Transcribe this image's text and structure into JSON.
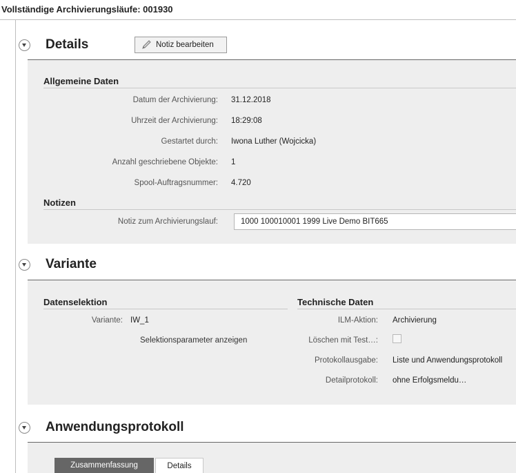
{
  "window": {
    "title": "Vollständige Archivierungsläufe: 001930"
  },
  "details": {
    "title": "Details",
    "edit_note_button": "Notiz bearbeiten",
    "general": {
      "title": "Allgemeine Daten",
      "fields": [
        {
          "label": "Datum der Archivierung:",
          "value": "31.12.2018"
        },
        {
          "label": "Uhrzeit der Archivierung:",
          "value": "18:29:08"
        },
        {
          "label": "Gestartet durch:",
          "value": "Iwona Luther (Wojcicka)"
        },
        {
          "label": "Anzahl geschriebene Objekte:",
          "value": "1"
        },
        {
          "label": "Spool-Auftragsnummer:",
          "value": "4.720"
        }
      ]
    },
    "notes": {
      "title": "Notizen",
      "label": "Notiz zum Archivierungslauf:",
      "value": "1000 100010001 1999 Live Demo BIT665"
    }
  },
  "variant": {
    "title": "Variante",
    "selection": {
      "title": "Datenselektion",
      "variant_label": "Variante:",
      "variant_value": "IW_1",
      "show_params_link": "Selektionsparameter anzeigen"
    },
    "technical": {
      "title": "Technische Daten",
      "ilm_label": "ILM-Aktion:",
      "ilm_value": "Archivierung",
      "delete_test_label": "Löschen mit Test…:",
      "delete_test_checked": false,
      "log_output_label": "Protokollausgabe:",
      "log_output_value": "Liste und Anwendungsprotokoll",
      "detail_log_label": "Detailprotokoll:",
      "detail_log_value": "ohne Erfolgsmeldu…"
    }
  },
  "app_log": {
    "title": "Anwendungsprotokoll",
    "tabs": [
      {
        "label": "Zusammenfassung",
        "active": true
      },
      {
        "label": "Details",
        "active": false
      }
    ]
  },
  "colors": {
    "panel_bg": "#eeeeee",
    "active_tab_bg": "#666666"
  }
}
